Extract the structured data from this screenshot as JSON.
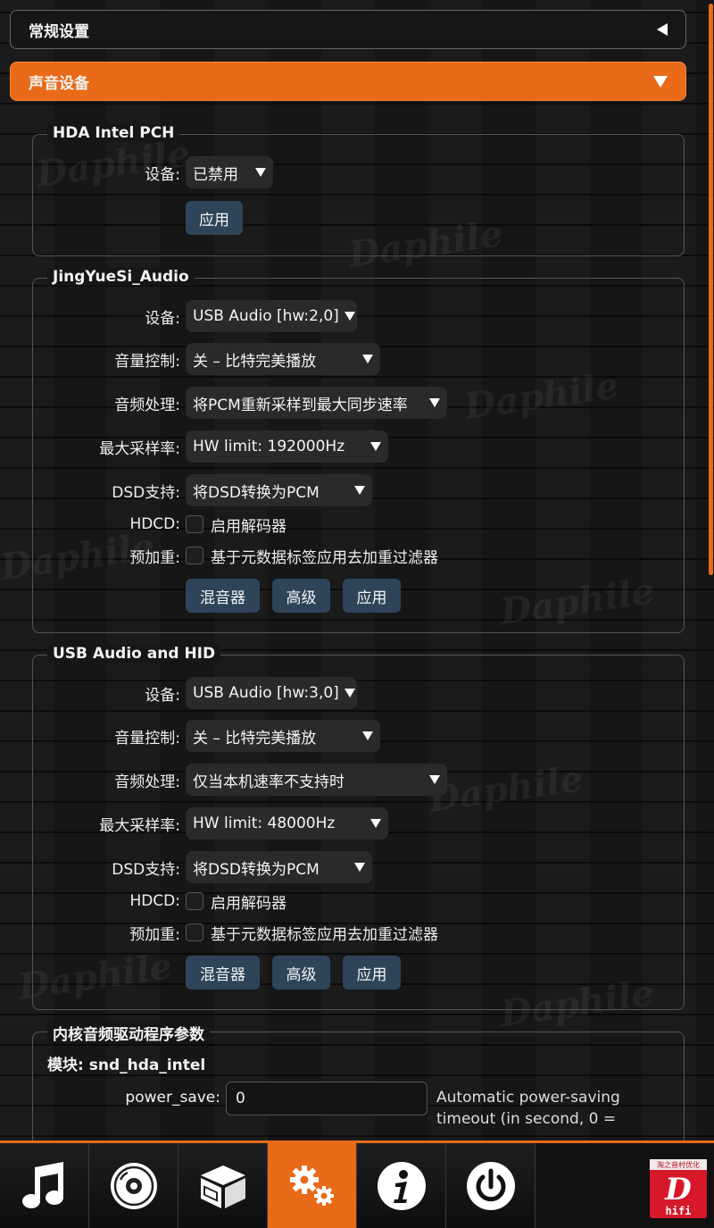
{
  "watermark": "Daphile",
  "panels": {
    "general": {
      "label": "常规设置"
    },
    "audio_devices": {
      "label": "声音设备"
    }
  },
  "hda": {
    "title": "HDA Intel PCH",
    "device_label": "设备:",
    "device_value": "已禁用",
    "apply_label": "应用"
  },
  "jys": {
    "title": "JingYueSi_Audio",
    "device_label": "设备:",
    "device_value": "USB Audio [hw:2,0]",
    "volume_label": "音量控制:",
    "volume_value": "关 – 比特完美播放",
    "processing_label": "音频处理:",
    "processing_value": "将PCM重新采样到最大同步速率",
    "maxrate_label": "最大采样率:",
    "maxrate_value": "HW limit: 192000Hz",
    "dsd_label": "DSD支持:",
    "dsd_value": "将DSD转换为PCM",
    "hdcd_label": "HDCD:",
    "hdcd_option": "启用解码器",
    "preemph_label": "预加重:",
    "preemph_option": "基于元数据标签应用去加重过滤器",
    "mixer_label": "混音器",
    "advanced_label": "高级",
    "apply_label": "应用"
  },
  "usbhid": {
    "title": "USB Audio and HID",
    "device_label": "设备:",
    "device_value": "USB Audio [hw:3,0]",
    "volume_label": "音量控制:",
    "volume_value": "关 – 比特完美播放",
    "processing_label": "音频处理:",
    "processing_value": "仅当本机速率不支持时",
    "maxrate_label": "最大采样率:",
    "maxrate_value": "HW limit: 48000Hz",
    "dsd_label": "DSD支持:",
    "dsd_value": "将DSD转换为PCM",
    "hdcd_label": "HDCD:",
    "hdcd_option": "启用解码器",
    "preemph_label": "预加重:",
    "preemph_option": "基于元数据标签应用去加重过滤器",
    "mixer_label": "混音器",
    "advanced_label": "高级",
    "apply_label": "应用"
  },
  "kernel": {
    "title": "内核音频驱动程序参数",
    "module_label": "模块: snd_hda_intel",
    "power_save_label": "power_save:",
    "power_save_value": "0",
    "power_save_desc_1": "Automatic power-saving",
    "power_save_desc_2": "timeout (in second, 0 ="
  },
  "nav": {
    "items": [
      {
        "icon": "music-note-icon",
        "active": false
      },
      {
        "icon": "disc-icon",
        "active": false
      },
      {
        "icon": "box-icon",
        "active": false
      },
      {
        "icon": "gears-icon",
        "active": true
      },
      {
        "icon": "info-icon",
        "active": false
      },
      {
        "icon": "power-icon",
        "active": false
      }
    ],
    "logo_top_text": "淘之音村优化",
    "logo_letter": "D",
    "logo_bottom_text": "hifi"
  },
  "colors": {
    "accent": "#e96a18",
    "button": "#2d4459",
    "background": "#161616"
  }
}
